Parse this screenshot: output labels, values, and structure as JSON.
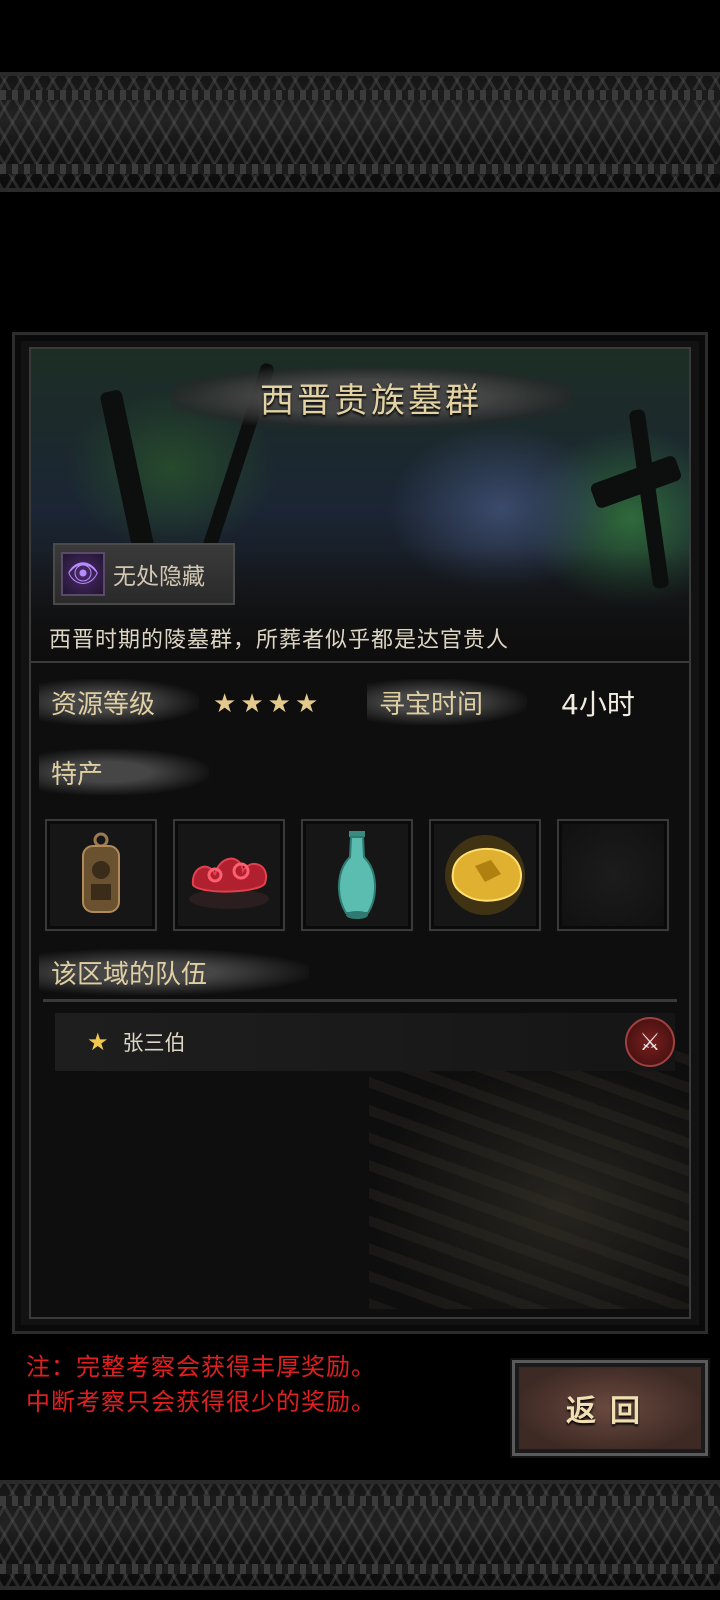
{
  "location": {
    "title": "西晋贵族墓群",
    "trait": {
      "label": "无处隐藏",
      "icon": "eye-icon"
    },
    "description": "西晋时期的陵墓群，所葬者似乎都是达官贵人"
  },
  "stats": {
    "resource_level_label": "资源等级",
    "resource_stars": 4,
    "search_time_label": "寻宝时间",
    "search_time_value": "4小时"
  },
  "specialties": {
    "label": "特产",
    "items": [
      {
        "icon": "bronze-plaque-icon"
      },
      {
        "icon": "red-coral-carving-icon"
      },
      {
        "icon": "celadon-vase-icon"
      },
      {
        "icon": "gold-nugget-icon"
      },
      {
        "icon": "empty-slot"
      }
    ]
  },
  "teams": {
    "label": "该区域的队伍",
    "list": [
      {
        "name": "张三伯",
        "icon": "star-icon",
        "action_icon": "crossed-swords-icon"
      }
    ]
  },
  "note": {
    "line1": "注：完整考察会获得丰厚奖励。",
    "line2": "中断考察只会获得很少的奖励。"
  },
  "back_button": {
    "label": "返回"
  },
  "colors": {
    "title_gold": "#e3d3a4",
    "warning_red": "#e02020",
    "star_gold": "#f2c94c"
  }
}
